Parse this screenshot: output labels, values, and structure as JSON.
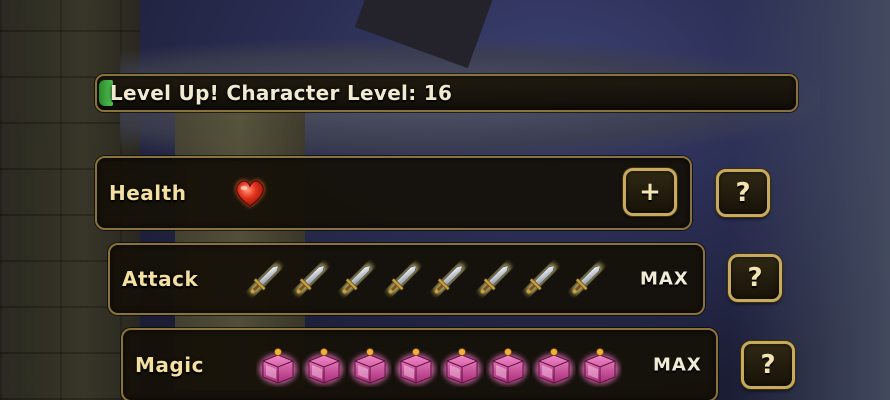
{
  "title_bar": {
    "text": "Level Up! Character Level: 16"
  },
  "stats": [
    {
      "label": "Health",
      "points": 1,
      "icon": "heart-icon",
      "status": "",
      "action": "+",
      "help": "?"
    },
    {
      "label": "Attack",
      "points": 8,
      "icon": "sword-icon",
      "status": "MAX",
      "help": "?"
    },
    {
      "label": "Magic",
      "points": 8,
      "icon": "spellbook-icon",
      "status": "MAX",
      "help": "?"
    }
  ],
  "colors": {
    "panel_border": "#8a7338",
    "button_border": "#c7aa5c",
    "label_text": "#f3dfa0",
    "progress_green": "#4fc14f"
  }
}
